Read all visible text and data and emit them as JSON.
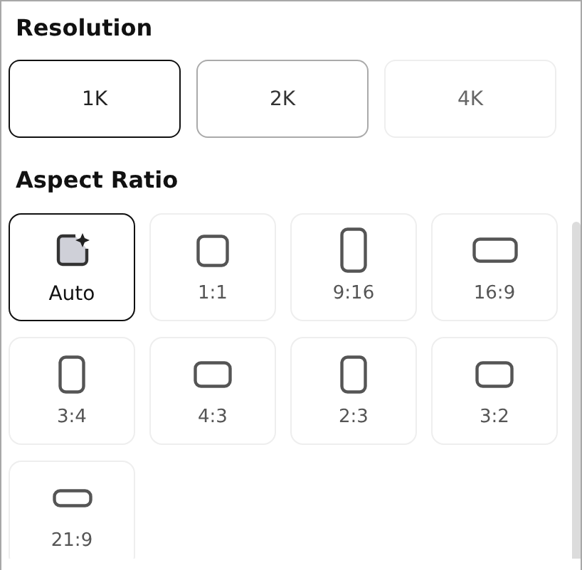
{
  "resolution": {
    "title": "Resolution",
    "options": [
      {
        "label": "1K",
        "selected": true,
        "disabled": false
      },
      {
        "label": "2K",
        "selected": false,
        "disabled": false
      },
      {
        "label": "4K",
        "selected": false,
        "disabled": true
      }
    ]
  },
  "aspect_ratio": {
    "title": "Aspect Ratio",
    "options": [
      {
        "label": "Auto",
        "kind": "auto",
        "selected": true
      },
      {
        "label": "1:1",
        "kind": "square",
        "selected": false
      },
      {
        "label": "9:16",
        "kind": "tall",
        "selected": false
      },
      {
        "label": "16:9",
        "kind": "wide",
        "selected": false
      },
      {
        "label": "3:4",
        "kind": "portrait",
        "selected": false
      },
      {
        "label": "4:3",
        "kind": "landscape",
        "selected": false
      },
      {
        "label": "2:3",
        "kind": "portrait",
        "selected": false
      },
      {
        "label": "3:2",
        "kind": "landscape",
        "selected": false
      },
      {
        "label": "21:9",
        "kind": "ultrawide",
        "selected": false
      }
    ]
  }
}
